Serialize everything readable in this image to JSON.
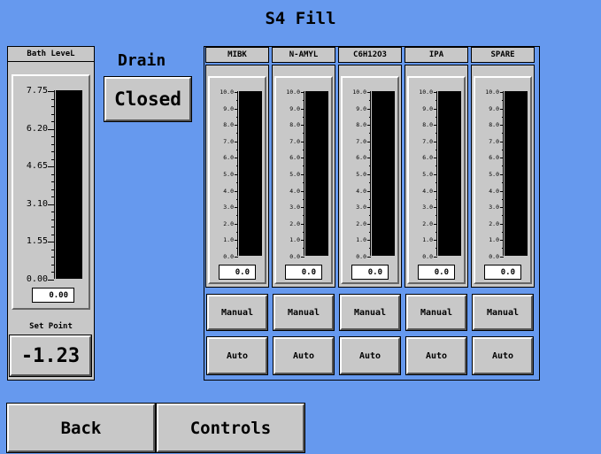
{
  "title": "S4 Fill",
  "bath": {
    "label": "Bath LeveL",
    "ticks": [
      "7.75",
      "6.20",
      "4.65",
      "3.10",
      "1.55",
      "0.00"
    ],
    "value": "0.00",
    "level_fraction": 0,
    "setpoint_label": "Set Point",
    "setpoint_value": "-1.23"
  },
  "drain": {
    "label": "Drain",
    "state": "Closed"
  },
  "tanks": [
    {
      "name": "MIBK",
      "value": "0.0",
      "manual": "Manual",
      "auto": "Auto"
    },
    {
      "name": "N-AMYL",
      "value": "0.0",
      "manual": "Manual",
      "auto": "Auto"
    },
    {
      "name": "C6H12O3",
      "value": "0.0",
      "manual": "Manual",
      "auto": "Auto"
    },
    {
      "name": "IPA",
      "value": "0.0",
      "manual": "Manual",
      "auto": "Auto"
    },
    {
      "name": "SPARE",
      "value": "0.0",
      "manual": "Manual",
      "auto": "Auto"
    }
  ],
  "tank_ticks": [
    "10.0",
    "9.0",
    "8.0",
    "7.0",
    "6.0",
    "5.0",
    "4.0",
    "3.0",
    "2.0",
    "1.0",
    "0.0"
  ],
  "nav": {
    "back": "Back",
    "controls": "Controls"
  },
  "colors": {
    "background": "#6699ee",
    "panel": "#c8c8c8",
    "bar": "#000000"
  }
}
